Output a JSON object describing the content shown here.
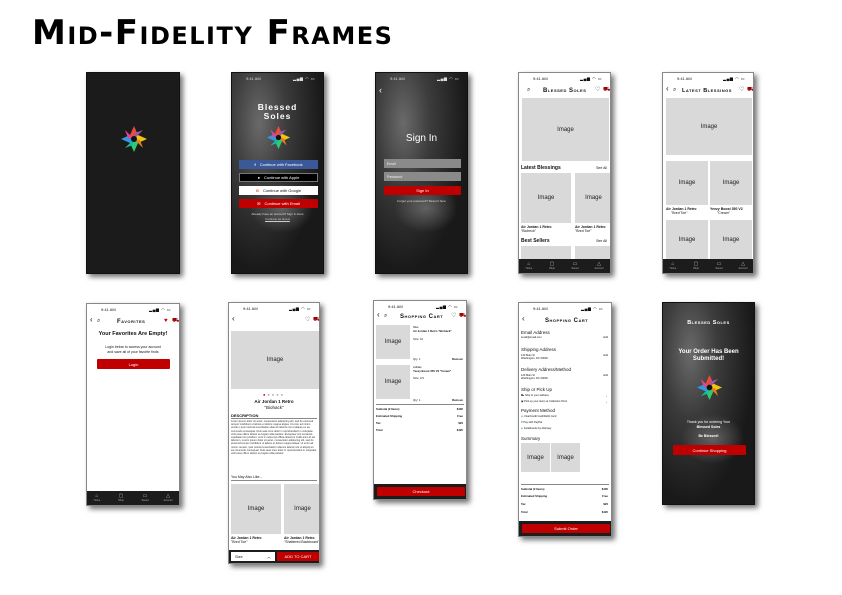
{
  "page": {
    "title": "Mid-Fidelity Frames"
  },
  "status": {
    "time": "9:41 AM",
    "signal": "▂▄▆ ◠ ▭"
  },
  "common": {
    "image": "Image",
    "back": "‹",
    "search": "⌕",
    "heart": "♡",
    "heart_filled": "♥",
    "cart": "🛒"
  },
  "tabs": [
    "Home",
    "Shop",
    "Saved",
    "Account"
  ],
  "welcome": {
    "brand_line1": "Blessed",
    "brand_line2": "Soles",
    "facebook": "Continue with Facebook",
    "apple": "Continue with Apple",
    "google": "Continue with Google",
    "email": "Continue with Email",
    "have_account": "Already have an account? Sign In Here",
    "guest": "Continue as Guest"
  },
  "signin": {
    "title": "Sign In",
    "email_placeholder": "Email",
    "password_placeholder": "Password",
    "button": "Sign In",
    "forgot": "Forgot your password? Reset it here"
  },
  "home": {
    "title": "Blessed Soles",
    "latest": "Latest Blessings",
    "see_all": "See All",
    "p1_name": "Air Jordan 1 Retro",
    "p1_sub": "\"Bioheck\"",
    "p2_name": "Air Jordan 1 Retro",
    "p2_sub": "\"Bred Toe\"",
    "best": "Best Sellers"
  },
  "latest_page": {
    "title": "Latest Blessings",
    "p1_name": "Air Jordan 1 Retro",
    "p1_sub": "\"Bred Toe\"",
    "p2_name": "Yeezy Boost 350 V2",
    "p2_sub": "\"Cream\""
  },
  "favorites": {
    "title": "Favorites",
    "empty": "Your Favorites Are Empty!",
    "msg1": "Login below to access your account",
    "msg2": "and save all of your favorite finds",
    "login": "Login"
  },
  "product": {
    "name": "Air Jordan 1 Retro",
    "sub": "\"Biohack\"",
    "desc_title": "DESCRIPTION",
    "desc": "Lorem ipsum dolor sit amet, consectetur adipiscing elit, sed do eiusmod tempor incididunt ut labore et dolore magna aliqua. Ut enim ad minim veniam, quis nostrud exercitation ullamco laboris nisi ut aliquip ex ea commodo consequat. Duis aute irure dolor in reprehenderit in voluptate velit esse cillum dolore eu fugiat nulla pariatur. Excepteur sint occaecat cupidatat non proident, sunt in culpa qui officia deserunt mollit anim id est laborum. Lorem ipsum dolor sit amet, consectetur adipiscing elit, sed do eiusmod tempor incididunt ut labore et dolore magna aliqua. Ut enim ad minim veniam, quis nostrud exercitation ullamco laboris nisi ut aliquip ex ea commodo consequat. Duis aute irure dolor in reprehenderit in voluptate velit esse cillum dolore eu fugiat nulla pariatur.",
    "may_like": "You May Also Like...",
    "r1_name": "Air Jordan 1 Retro",
    "r1_sub": "\"Bred Toe\"",
    "r2_name": "Air Jordan 1 Retro",
    "r2_sub": "\"Shattered Backboard\"",
    "size": "Size",
    "add": "ADD TO CART"
  },
  "cart": {
    "title": "Shopping Cart",
    "i1_brand": "Nike",
    "i1_name": "Air Jordan 1 Retro \"Biohack\"",
    "i1_size": "Size: 10",
    "i1_qty": "Qty: 1",
    "i2_brand": "Adidas",
    "i2_name": "Yeezy Boost 350 V2 \"Cream\"",
    "i2_size": "Size: 9.5",
    "i2_qty": "Qty: 1",
    "remove": "Remove",
    "subtotal": "Subtotal (2 Items)",
    "subtotal_v": "$400",
    "shipping": "Estimated Shipping",
    "shipping_v": "Free",
    "tax": "Tax",
    "tax_v": "$20",
    "total": "Total",
    "total_v": "$420",
    "checkout": "Checkout"
  },
  "checkout": {
    "title": "Shopping Cart",
    "email": "Email Address",
    "email_v": "email@email.com",
    "edit": "Edit",
    "shipping_addr": "Shipping Address",
    "addr1": "123 Main St",
    "addr2": "Washington, DC 20000",
    "delivery": "Delivery Address/Method",
    "ship_or": "Ship or Pick Up",
    "ship_opt": "Ship to your address",
    "pick_opt": "Pick up your items at Collection Point",
    "payment": "Payment Method",
    "pay1": "Visa/Credit Card/Debit Card",
    "pay2": "Pay with PayPal",
    "pay3": "Installments by Afterpay",
    "summary": "Summary",
    "subtotal": "Subtotal (2 Items)",
    "subtotal_v": "$400",
    "shipping": "Estimated Shipping",
    "shipping_v": "Free",
    "tax": "Tax",
    "tax_v": "$20",
    "total": "Total",
    "total_v": "$420",
    "submit": "Submit Order"
  },
  "confirm": {
    "brand": "Blessed Soles",
    "msg1": "Your Order Has Been",
    "msg2": "Submitted!",
    "thanks1": "Thank you for ordering Your",
    "thanks2": "Blessed Soles",
    "blessed": "Be Blessed!",
    "continue": "Continue Shopping"
  }
}
